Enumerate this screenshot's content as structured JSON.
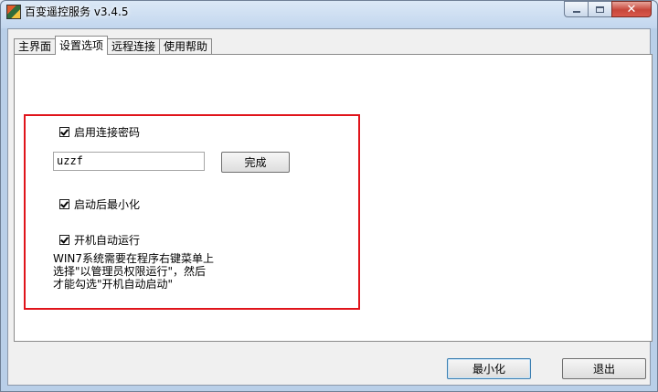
{
  "window": {
    "title": "百变遥控服务 v3.4.5",
    "accent_color": "#e0141b",
    "caption_icons": [
      "minimize-icon",
      "maximize-icon",
      "close-icon"
    ]
  },
  "tabs": [
    {
      "label": "主界面",
      "active": false
    },
    {
      "label": "设置选项",
      "active": true
    },
    {
      "label": "远程连接",
      "active": false
    },
    {
      "label": "使用帮助",
      "active": false
    }
  ],
  "settings": {
    "enable_password": {
      "label": "启用连接密码",
      "checked": true
    },
    "password_value": "uzzf",
    "done_label": "完成",
    "minimize_after_start": {
      "label": "启动后最小化",
      "checked": true
    },
    "auto_run": {
      "label": "开机自动运行",
      "checked": true
    },
    "note_lines": [
      "WIN7系统需要在程序右键菜单上",
      "选择\"以管理员权限运行\"，然后",
      "才能勾选\"开机自动启动\""
    ]
  },
  "footer": {
    "minimize_label": "最小化",
    "exit_label": "退出"
  }
}
